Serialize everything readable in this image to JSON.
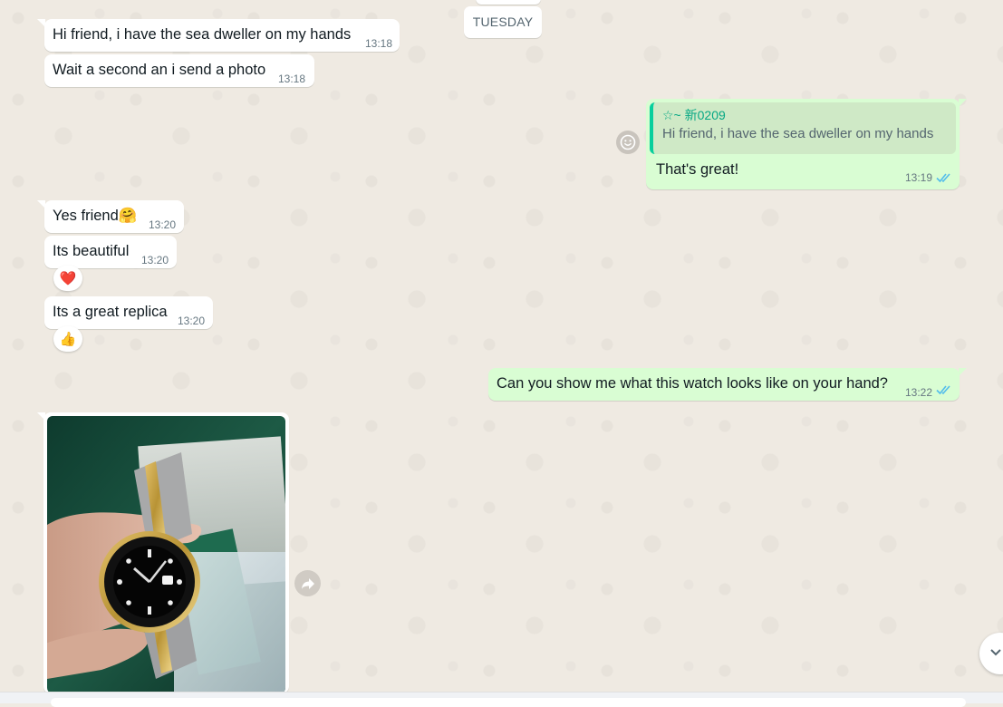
{
  "day_separator": "TUESDAY",
  "messages": [
    {
      "text": "Hi friend, i have the sea dweller on my hands",
      "time": "13:18"
    },
    {
      "text": "Wait a second an i send a photo",
      "time": "13:18"
    },
    {
      "quoted_author": "☆~ 新0209",
      "quoted_text": "Hi friend, i have the sea dweller on my hands",
      "text": "That's great!",
      "time": "13:19"
    },
    {
      "text": "Yes friend",
      "emoji": "🤗",
      "time": "13:20"
    },
    {
      "text": "Its beautiful",
      "time": "13:20",
      "reaction": "❤️"
    },
    {
      "text": "Its a great replica",
      "time": "13:20",
      "reaction": "👍"
    },
    {
      "text": "Can you show me what this watch looks like on your hand?",
      "time": "13:22"
    }
  ],
  "icons": {
    "read_receipt": "double-check-icon",
    "forward": "forward-icon",
    "avatar": "smiley-icon",
    "scroll": "chevron-down-icon"
  },
  "colors": {
    "chat_bg": "#efeae2",
    "incoming": "#ffffff",
    "outgoing": "#d9fdd3",
    "read_tick": "#53bdeb",
    "quote_accent": "#06cf9c"
  }
}
